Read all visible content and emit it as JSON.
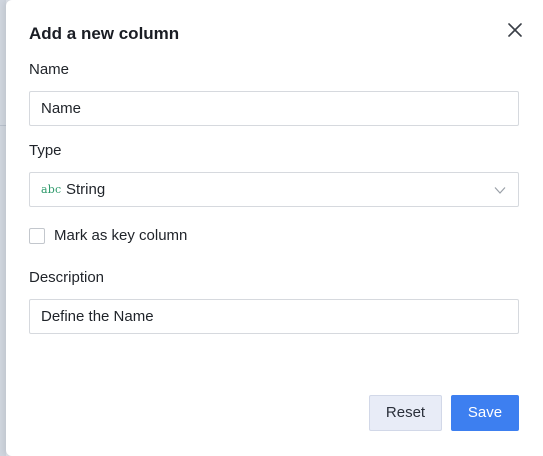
{
  "dialog": {
    "title": "Add a new column",
    "close_icon": "close-icon"
  },
  "fields": {
    "name": {
      "label": "Name",
      "value": "",
      "placeholder": "Name"
    },
    "type": {
      "label": "Type",
      "icon_text": "abc",
      "value": "String",
      "icon": "chevron-down-icon"
    },
    "key_column": {
      "label": "Mark as key column",
      "checked": false
    },
    "description": {
      "label": "Description",
      "value": "",
      "placeholder": "Define the Name"
    }
  },
  "actions": {
    "reset_label": "Reset",
    "save_label": "Save"
  },
  "colors": {
    "primary": "#3d7ff0",
    "secondary_bg": "#e8ecf7",
    "type_icon": "#2e9a6b"
  }
}
